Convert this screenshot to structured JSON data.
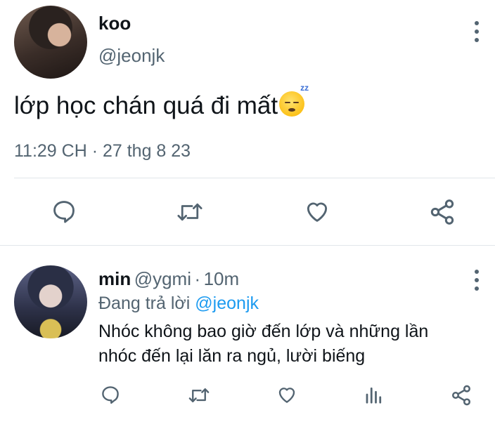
{
  "main_tweet": {
    "display_name": "koo",
    "handle": "@jeonjk",
    "text": "lớp học chán quá đi mất",
    "emoji": "sleeping-face-emoji",
    "timestamp": "11:29 CH · 27 thg 8 23"
  },
  "actions": {
    "reply_icon": "reply-icon",
    "retweet_icon": "retweet-icon",
    "like_icon": "heart-icon",
    "share_icon": "share-icon",
    "analytics_icon": "analytics-icon"
  },
  "reply_tweet": {
    "display_name": "min",
    "handle": "@ygmi",
    "separator": "·",
    "time_ago": "10m",
    "replying_to_label": "Đang trả lời",
    "replying_to_handle": "@jeonjk",
    "text_line1": "Nhóc không bao giờ đến lớp và những lần",
    "text_line2": "nhóc đến lại lăn ra ngủ, lười biếng"
  },
  "colors": {
    "text_primary": "#0f1419",
    "text_secondary": "#536471",
    "accent": "#1d9bf0",
    "divider": "#e1e6ea"
  }
}
